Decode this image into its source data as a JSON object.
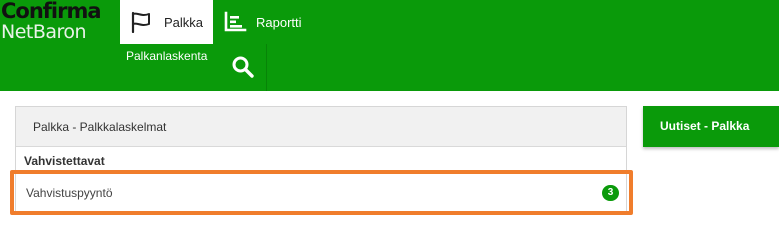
{
  "logo": {
    "line1": "Confirma",
    "line2": "NetBaron"
  },
  "nav": {
    "palkka": "Palkka",
    "raportti": "Raportti",
    "palkanlaskenta": "Palkanlaskenta"
  },
  "panel": {
    "title": "Palkka - Palkkalaskelmat",
    "section": "Vahvistettavat",
    "item_label": "Vahvistuspyyntö",
    "item_count": "3"
  },
  "news": {
    "title": "Uutiset - Palkka"
  },
  "colors": {
    "brand_green": "#0a9a0a",
    "highlight_orange": "#f07d2c"
  },
  "icons": [
    "flag-icon",
    "report-chart-icon",
    "search-icon"
  ]
}
